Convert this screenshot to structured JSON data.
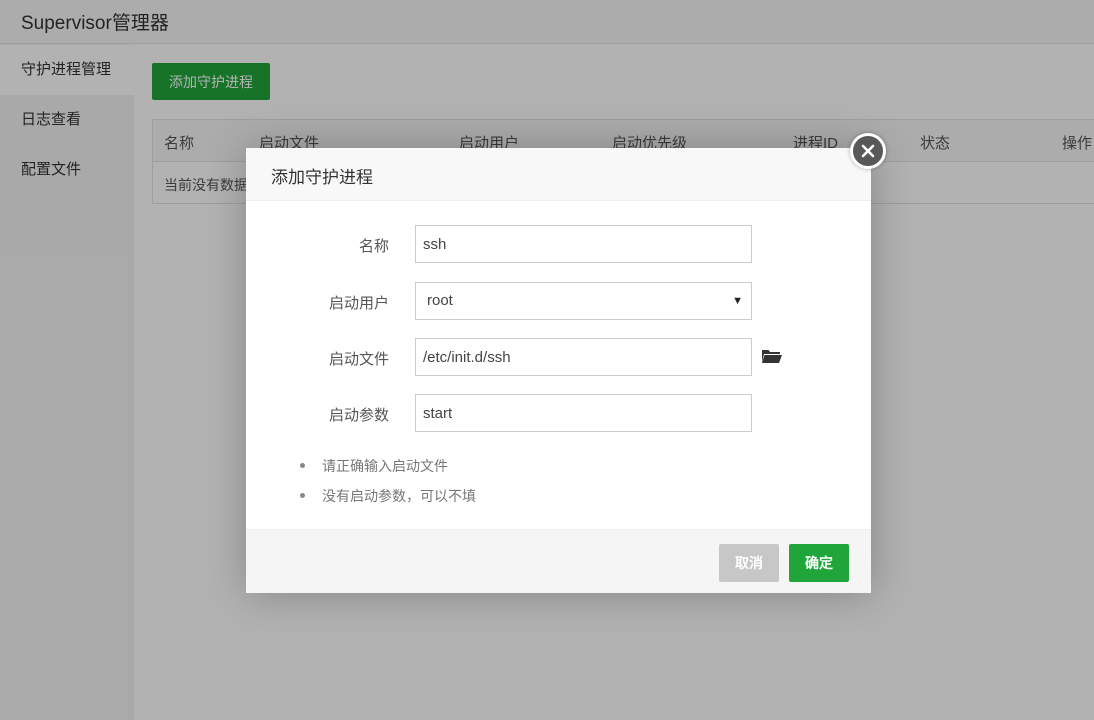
{
  "app": {
    "title": "Supervisor管理器"
  },
  "sidebar": {
    "items": [
      {
        "label": "守护进程管理",
        "active": true
      },
      {
        "label": "日志查看",
        "active": false
      },
      {
        "label": "配置文件",
        "active": false
      }
    ]
  },
  "main": {
    "add_button": "添加守护进程",
    "table": {
      "columns": [
        "名称",
        "启动文件",
        "启动用户",
        "启动优先级",
        "进程ID",
        "状态",
        "操作"
      ],
      "empty_text": "当前没有数据"
    }
  },
  "modal": {
    "title": "添加守护进程",
    "fields": {
      "name": {
        "label": "名称",
        "value": "ssh"
      },
      "user": {
        "label": "启动用户",
        "value": "root"
      },
      "file": {
        "label": "启动文件",
        "value": "/etc/init.d/ssh"
      },
      "args": {
        "label": "启动参数",
        "value": "start"
      }
    },
    "tips": [
      "请正确输入启动文件",
      "没有启动参数，可以不填"
    ],
    "cancel": "取消",
    "confirm": "确定"
  },
  "colors": {
    "accent": "#20a53a",
    "overlay": "rgba(0,0,0,0.3)"
  }
}
